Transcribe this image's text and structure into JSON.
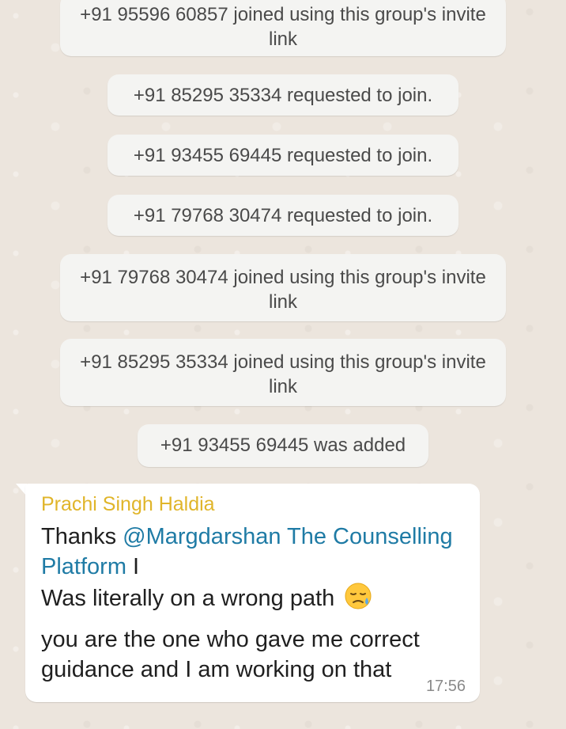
{
  "system_messages": [
    {
      "text": "+91 95596 60857 joined using this group's invite link"
    },
    {
      "text": "+91 85295 35334 requested to join."
    },
    {
      "text": "+91 93455 69445 requested to join."
    },
    {
      "text": "+91 79768 30474 requested to join."
    },
    {
      "text": "+91 79768 30474 joined using this group's invite link"
    },
    {
      "text": "+91 85295 35334 joined using this group's invite link"
    },
    {
      "text": "+91 93455 69445 was added"
    }
  ],
  "message": {
    "sender": "Prachi Singh Haldia",
    "text_before_mention": "Thanks ",
    "mention": "@Margdarshan The Counselling Platform",
    "text_after_mention": " I",
    "line2": "Was literally on a wrong path",
    "line3": "you are the one who gave me correct guidance and I am working on that",
    "emoji": "sad-relieved-face-icon",
    "time": "17:56"
  },
  "colors": {
    "chat_background": "#ECE5DD",
    "system_bubble": "#F4F4F2",
    "sender_name": "#E0B52A",
    "mention": "#1F7BA5"
  }
}
